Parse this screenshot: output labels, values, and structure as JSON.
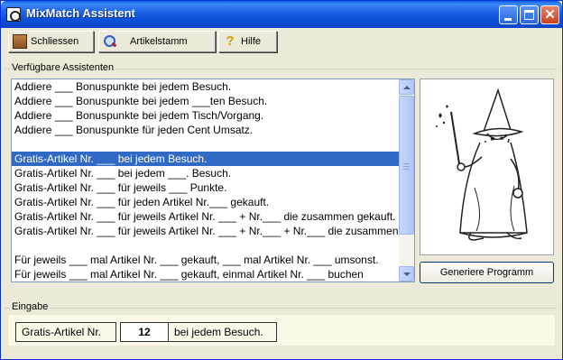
{
  "window": {
    "title": "MixMatch Assistent"
  },
  "toolbar": {
    "close_label": "Schliessen",
    "article_label": "Artikelstamm",
    "help_label": "Hilfe"
  },
  "groups": {
    "assistants_label": "Verfügbare Assistenten",
    "input_label": "Eingabe"
  },
  "list": {
    "items": [
      "Addiere ___ Bonuspunkte bei jedem Besuch.",
      "Addiere ___ Bonuspunkte bei jedem ___ten Besuch.",
      "Addiere ___ Bonuspunkte bei jedem Tisch/Vorgang.",
      "Addiere ___ Bonuspunkte für jeden Cent Umsatz.",
      "",
      "Gratis-Artikel Nr. ___  bei jedem Besuch.",
      "Gratis-Artikel Nr. ___ bei jedem ___. Besuch.",
      "Gratis-Artikel Nr. ___ für jeweils ___ Punkte.",
      "Gratis-Artikel Nr. ___ für jeden Artikel  Nr.___  gekauft.",
      "Gratis-Artikel Nr. ___ für jeweils Artikel Nr. ___ +  Nr.___  die zusammen gekauft.",
      "Gratis-Artikel Nr. ___ für jeweils Artikel Nr. ___ +  Nr.___ +  Nr.___  die zusammen gekauft.",
      "",
      "Für jeweils ___ mal Artikel Nr. ___ gekauft, ___ mal Artikel Nr. ___ umsonst.",
      "Für jeweils ___ mal Artikel Nr. ___ gekauft, einmal Artikel Nr. ___ buchen"
    ],
    "selected_index": 5
  },
  "generate_button": "Generiere Programm",
  "input": {
    "label_before": "Gratis-Artikel Nr.",
    "value": "12",
    "label_after": "bei jedem Besuch."
  },
  "colors": {
    "selection": "#316ac5",
    "titlebar": "#0a50d8",
    "input_strip": "#fbf8e8"
  }
}
